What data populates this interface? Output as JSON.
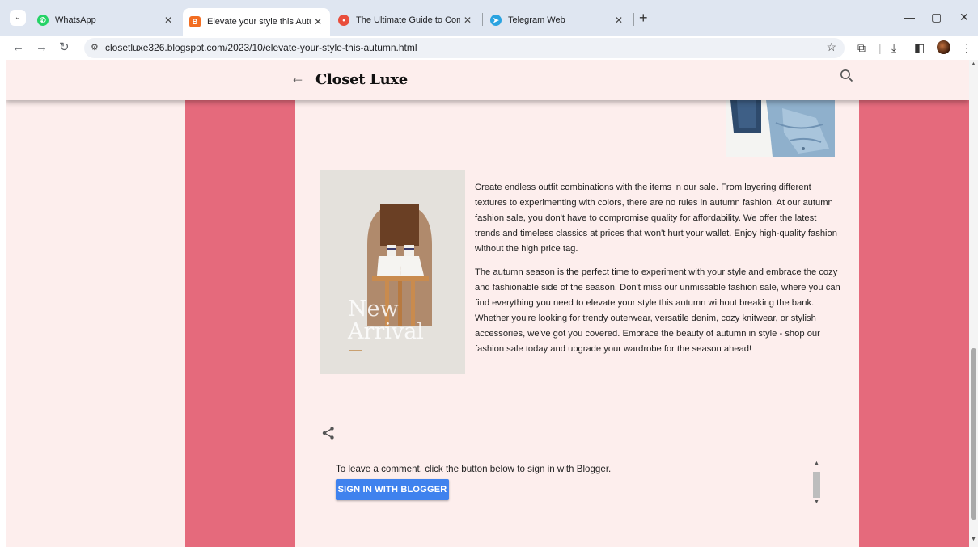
{
  "browser": {
    "tabs": [
      {
        "title": "WhatsApp",
        "favicon_color": "#25d366"
      },
      {
        "title": "Elevate your style this Autumn",
        "favicon_color": "#f26d21",
        "active": true
      },
      {
        "title": "The Ultimate Guide to Content",
        "favicon_color": "#e94e3c"
      },
      {
        "title": "Telegram Web",
        "favicon_color": "#2aa3e0"
      }
    ],
    "url": "closetluxe326.blogspot.com/2023/10/elevate-your-style-this-autumn.html"
  },
  "blog": {
    "title": "Closet Luxe",
    "accent_color": "#e56a7c",
    "background_color": "#fdeeed"
  },
  "article": {
    "image_caption_line1": "New",
    "image_caption_line2": "Arrival",
    "paragraphs": [
      "Create endless outfit combinations with the items in our sale. From layering different textures to experimenting with colors, there are no rules in autumn fashion. At our autumn fashion sale, you don't have to compromise quality for affordability. We offer the latest trends and timeless classics at prices that won't hurt your wallet. Enjoy high-quality fashion without the high price tag.",
      "The autumn season is the perfect time to experiment with your style and embrace the cozy and fashionable side of the season. Don't miss our unmissable fashion sale, where you can find everything you need to elevate your style this autumn without breaking the bank. Whether you're looking for trendy outerwear, versatile denim, cozy knitwear, or stylish accessories, we've got you covered. Embrace the beauty of autumn in style - shop our fashion sale today and upgrade your wardrobe for the season ahead!"
    ]
  },
  "comments": {
    "prompt": "To leave a comment, click the button below to sign in with Blogger.",
    "sign_in_label": "SIGN IN WITH BLOGGER",
    "button_color": "#3f82ee"
  },
  "icons": {
    "back": "back-arrow-icon",
    "search": "search-icon",
    "share": "share-icon"
  }
}
